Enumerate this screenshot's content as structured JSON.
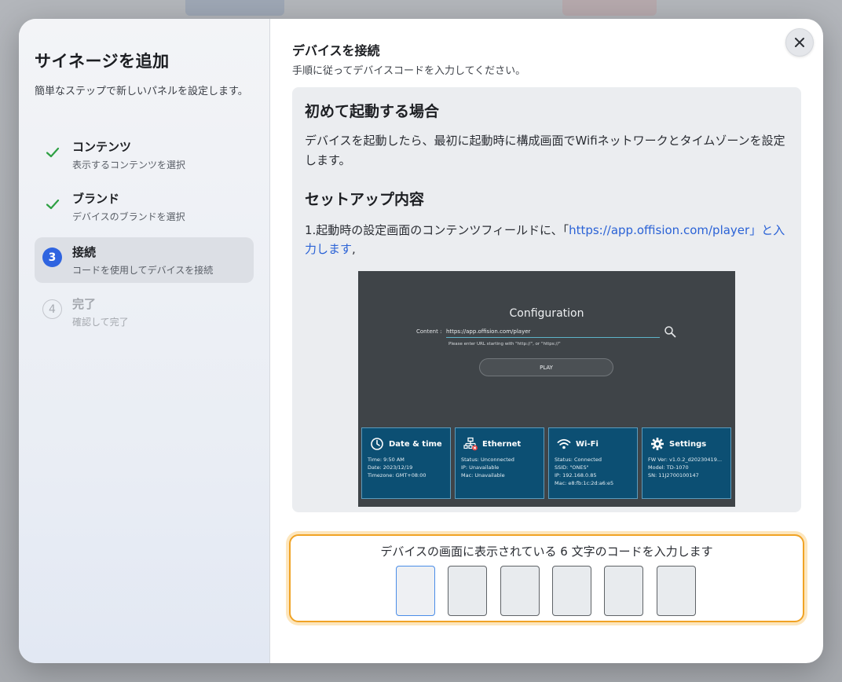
{
  "sidebar": {
    "title": "サイネージを追加",
    "description": "簡単なステップで新しいパネルを設定します。",
    "steps": [
      {
        "title": "コンテンツ",
        "subtitle": "表示するコンテンツを選択",
        "state": "done"
      },
      {
        "title": "ブランド",
        "subtitle": "デバイスのブランドを選択",
        "state": "done"
      },
      {
        "number": "3",
        "title": "接続",
        "subtitle": "コードを使用してデバイスを接続",
        "state": "active"
      },
      {
        "number": "4",
        "title": "完了",
        "subtitle": "確認して完了",
        "state": "pending"
      }
    ]
  },
  "main": {
    "title": "デバイスを接続",
    "subtitle": "手順に従ってデバイスコードを入力してください。",
    "close_icon": "close-icon",
    "info": {
      "heading1": "初めて起動する場合",
      "paragraph1": "デバイスを起動したら、最初に起動時に構成画面でWifiネットワークとタイムゾーンを設定します。",
      "heading2": "セットアップ内容",
      "paragraph2_prefix": "1.起動時の設定画面のコンテンツフィールドに、「",
      "paragraph2_link": "https://app.offision.com/player」と入力します",
      "paragraph2_suffix": ","
    },
    "config_screen": {
      "title": "Configuration",
      "content_label": "Content :",
      "content_value": "https://app.offision.com/player",
      "hint": "Please enter URL starting with \"http://\", or \"https://\"",
      "play_label": "PLAY",
      "tiles": [
        {
          "icon": "clock-icon",
          "title": "Date & time",
          "lines": [
            "Time: 9:50 AM",
            "Date: 2023/12/19",
            "Timezone: GMT+08:00"
          ]
        },
        {
          "icon": "ethernet-icon",
          "title": "Ethernet",
          "lines": [
            "Status: Unconnected",
            "IP: Unavailable",
            "Mac: Unavailable"
          ]
        },
        {
          "icon": "wifi-icon",
          "title": "Wi-Fi",
          "lines": [
            "Status: Connected",
            "SSID: \"ONES\"",
            "IP: 192.168.0.85",
            "Mac: e8:fb:1c:2d:a6:e5"
          ]
        },
        {
          "icon": "gear-icon",
          "title": "Settings",
          "lines": [
            "FW Ver: v1.0.2_d20230419...",
            "Model: TD-1070",
            "SN: 11J2700100147"
          ]
        }
      ]
    },
    "code_entry": {
      "label": "デバイスの画面に表示されている 6 文字のコードを入力します",
      "cells": [
        "",
        "",
        "",
        "",
        "",
        ""
      ]
    }
  },
  "colors": {
    "accent": "#2f64e0",
    "check": "#2ea043",
    "link": "#2a62d6",
    "code_border": "#f0a325",
    "tile_bg": "#0c4f73"
  }
}
